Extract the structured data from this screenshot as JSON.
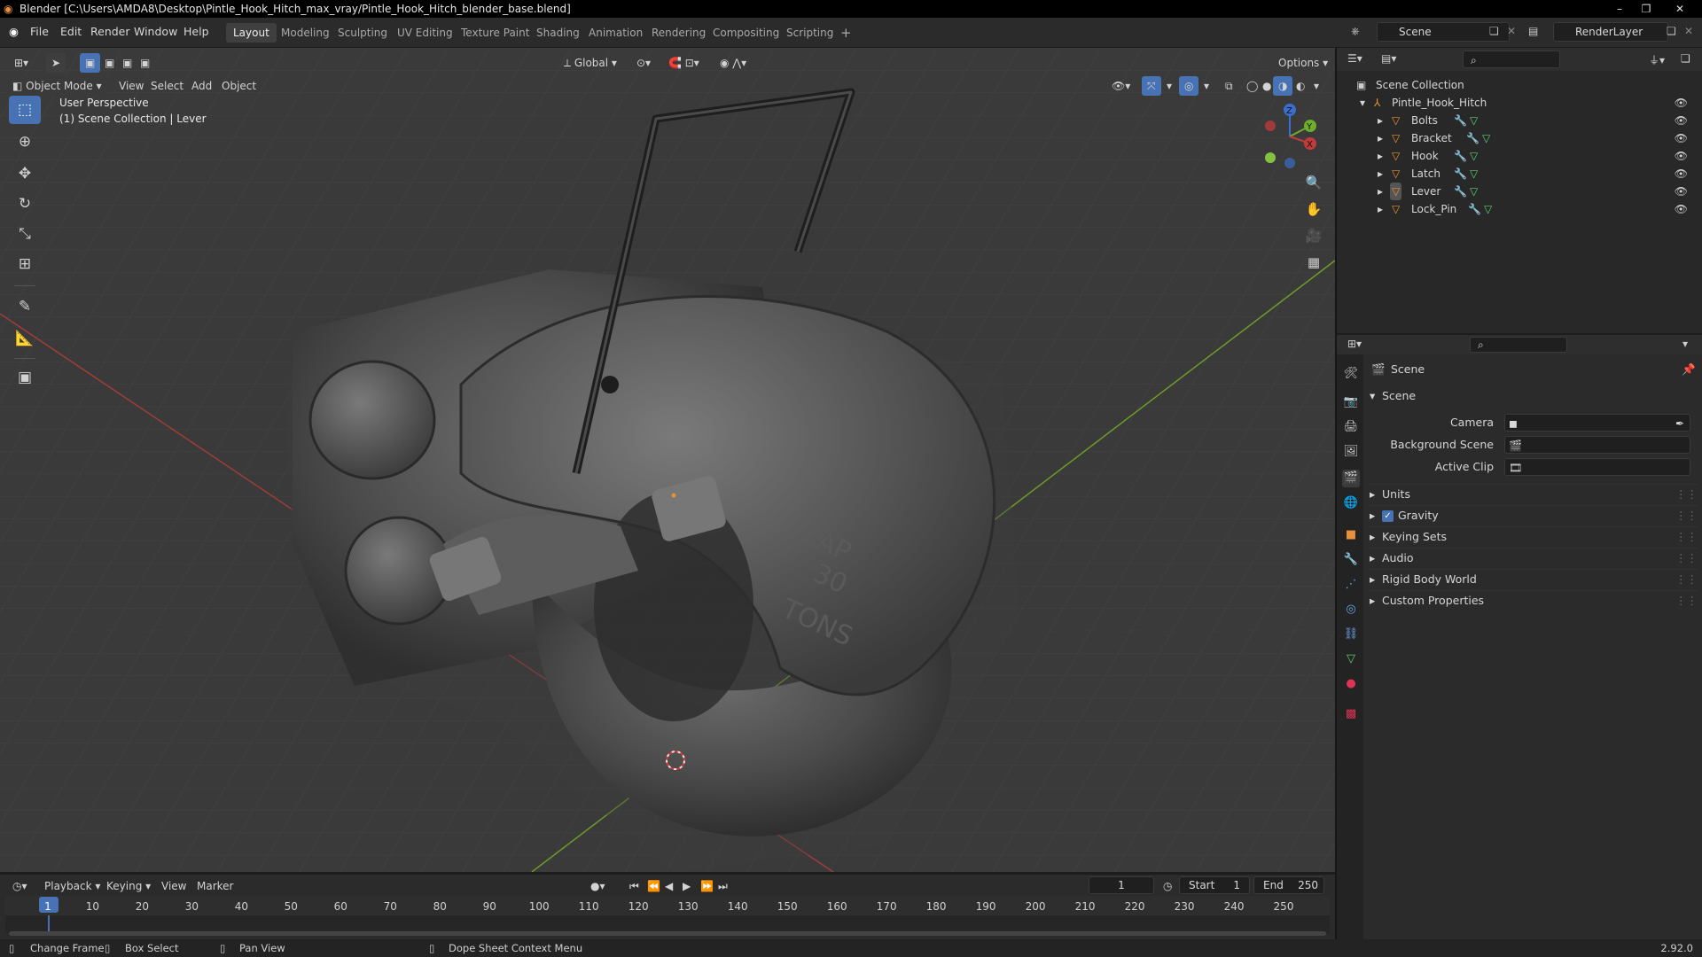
{
  "window_title": "Blender [C:\\Users\\AMDA8\\Desktop\\Pintle_Hook_Hitch_max_vray/Pintle_Hook_Hitch_blender_base.blend]",
  "menu": [
    "File",
    "Edit",
    "Render",
    "Window",
    "Help"
  ],
  "workspace_tabs": [
    "Layout",
    "Modeling",
    "Sculpting",
    "UV Editing",
    "Texture Paint",
    "Shading",
    "Animation",
    "Rendering",
    "Compositing",
    "Scripting"
  ],
  "active_workspace": "Layout",
  "scene_field": "Scene",
  "view_layer_field": "RenderLayer",
  "viewport": {
    "mode": "Object Mode",
    "menus": [
      "View",
      "Select",
      "Add",
      "Object"
    ],
    "orientation": "Global",
    "options_label": "Options",
    "overlay_line1": "User Perspective",
    "overlay_line2": "(1) Scene Collection | Lever",
    "hook_text": [
      "CAP",
      "30",
      "TONS"
    ],
    "gizmo_axes": {
      "x": "X",
      "y": "Y",
      "z": "Z"
    }
  },
  "outliner": {
    "root": "Scene Collection",
    "collection": "Pintle_Hook_Hitch",
    "objects": [
      "Bolts",
      "Bracket",
      "Hook",
      "Latch",
      "Lever",
      "Lock_Pin"
    ]
  },
  "properties": {
    "context": "Scene",
    "section": "Scene",
    "fields": [
      {
        "label": "Camera",
        "value": ""
      },
      {
        "label": "Background Scene",
        "value": ""
      },
      {
        "label": "Active Clip",
        "value": ""
      }
    ],
    "panels": [
      "Units",
      "Gravity",
      "Keying Sets",
      "Audio",
      "Rigid Body World",
      "Custom Properties"
    ],
    "gravity_checked": true
  },
  "timeline": {
    "menus": [
      "Playback",
      "Keying",
      "View",
      "Marker"
    ],
    "current_frame": "1",
    "start_label": "Start",
    "start_value": "1",
    "end_label": "End",
    "end_value": "250",
    "ticks": [
      "1",
      "10",
      "20",
      "30",
      "40",
      "50",
      "60",
      "70",
      "80",
      "90",
      "100",
      "110",
      "120",
      "130",
      "140",
      "150",
      "160",
      "170",
      "180",
      "190",
      "200",
      "210",
      "220",
      "230",
      "240",
      "250"
    ]
  },
  "statusbar": {
    "items": [
      "Change Frame",
      "Box Select",
      "Pan View",
      "Dope Sheet Context Menu"
    ],
    "version": "2.92.0"
  },
  "colors": {
    "accent": "#4772b3",
    "object_orange": "#e8913a",
    "mesh_green": "#5fcf70"
  }
}
